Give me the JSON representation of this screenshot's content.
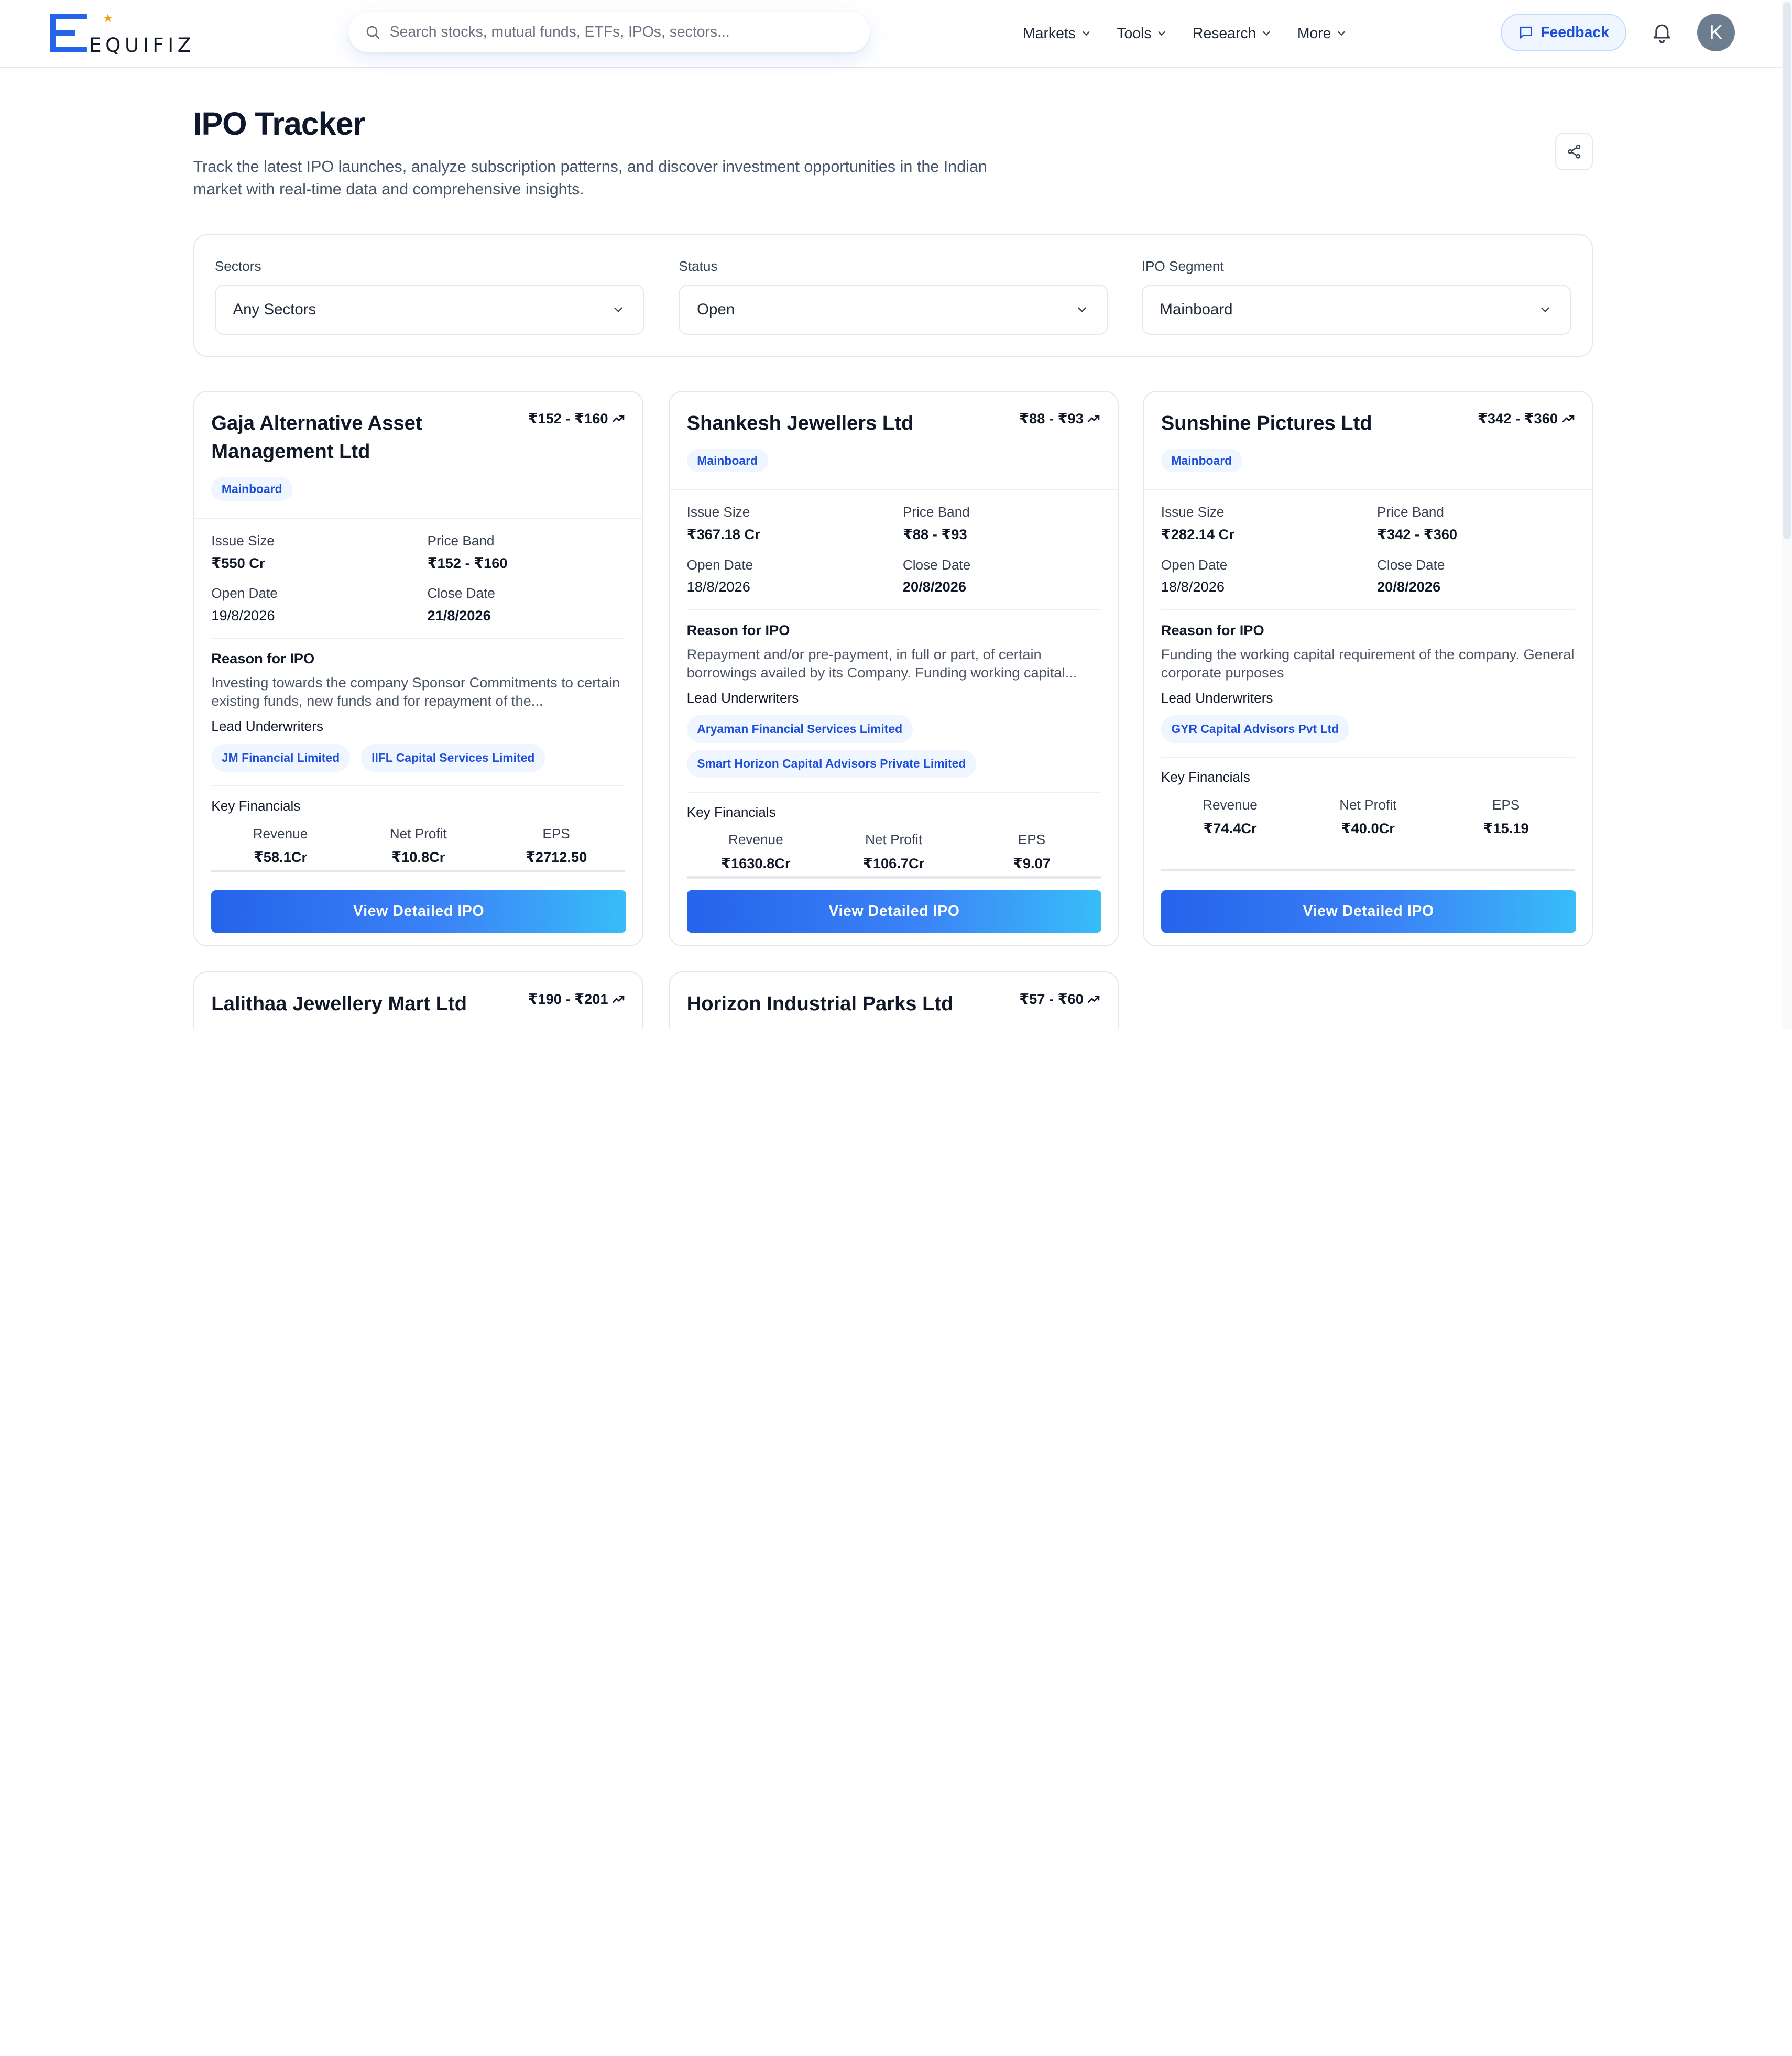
{
  "brand": {
    "logo_text": "EQUIFIZ",
    "accent": "#2563eb"
  },
  "header": {
    "search_placeholder": "Search stocks, mutual funds, ETFs, IPOs, sectors...",
    "nav": [
      {
        "label": "Markets"
      },
      {
        "label": "Tools"
      },
      {
        "label": "Research"
      },
      {
        "label": "More"
      }
    ],
    "feedback_label": "Feedback",
    "avatar_initial": "K"
  },
  "page": {
    "title": "IPO Tracker",
    "subtitle": "Track the latest IPO launches, analyze subscription patterns, and discover investment opportunities in the Indian market with real-time data and comprehensive insights."
  },
  "filters": [
    {
      "label": "Sectors",
      "value": "Any Sectors"
    },
    {
      "label": "Status",
      "value": "Open"
    },
    {
      "label": "IPO Segment",
      "value": "Mainboard"
    }
  ],
  "card_labels": {
    "issue_size": "Issue Size",
    "price_band": "Price Band",
    "open_date": "Open Date",
    "close_date": "Close Date",
    "reason": "Reason for IPO",
    "underwriters": "Lead Underwriters",
    "financials": "Key Financials",
    "revenue": "Revenue",
    "net_profit": "Net Profit",
    "eps": "EPS",
    "button": "View Detailed IPO"
  },
  "cards": [
    {
      "name": "Gaja Alternative Asset Management Ltd",
      "price_range": "₹152 - ₹160",
      "segment": "Mainboard",
      "issue_size": "₹550 Cr",
      "price_band": "₹152 - ₹160",
      "open_date": "19/8/2026",
      "close_date": "21/8/2026",
      "reason": "Investing towards the company Sponsor Commitments to certain existing funds, new funds and for repayment of the...",
      "underwriters": [
        "JM Financial Limited",
        "IIFL Capital Services Limited"
      ],
      "revenue": "₹58.1Cr",
      "net_profit": "₹10.8Cr",
      "eps": "₹2712.50"
    },
    {
      "name": "Shankesh Jewellers Ltd",
      "price_range": "₹88 - ₹93",
      "segment": "Mainboard",
      "issue_size": "₹367.18 Cr",
      "price_band": "₹88 - ₹93",
      "open_date": "18/8/2026",
      "close_date": "20/8/2026",
      "reason": "Repayment and/or pre-payment, in full or part, of certain borrowings availed by its Company. Funding working capital...",
      "underwriters": [
        "Aryaman Financial Services Limited",
        "Smart Horizon Capital Advisors Private Limited"
      ],
      "revenue": "₹1630.8Cr",
      "net_profit": "₹106.7Cr",
      "eps": "₹9.07"
    },
    {
      "name": "Sunshine Pictures Ltd",
      "price_range": "₹342 - ₹360",
      "segment": "Mainboard",
      "issue_size": "₹282.14 Cr",
      "price_band": "₹342 - ₹360",
      "open_date": "18/8/2026",
      "close_date": "20/8/2026",
      "reason": "Funding the working capital requirement of the company. General corporate purposes",
      "underwriters": [
        "GYR Capital Advisors Pvt Ltd"
      ],
      "revenue": "₹74.4Cr",
      "net_profit": "₹40.0Cr",
      "eps": "₹15.19"
    },
    {
      "name": "Lalithaa Jewellery Mart Ltd",
      "price_range": "₹190 - ₹201"
    },
    {
      "name": "Horizon Industrial Parks Ltd",
      "price_range": "₹57 - ₹60"
    }
  ]
}
